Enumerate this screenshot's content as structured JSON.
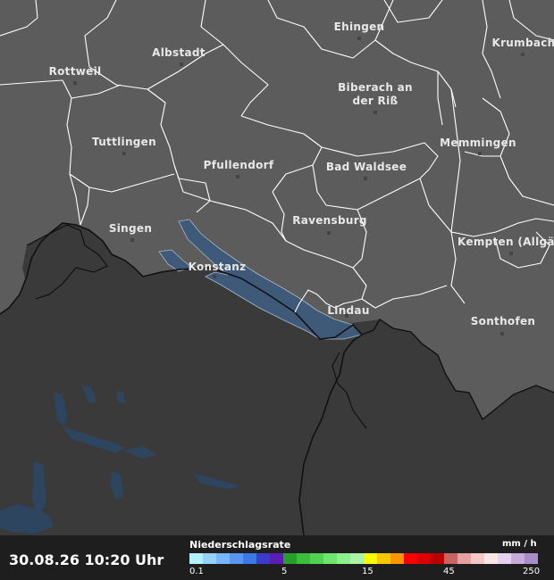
{
  "cities": [
    {
      "name": "Ehingen"
    },
    {
      "name": "Krumbach"
    },
    {
      "name": "Albstadt"
    },
    {
      "name": "Rottweil"
    },
    {
      "name": "Biberach an"
    },
    {
      "name": "der Riß"
    },
    {
      "name": "Tuttlingen"
    },
    {
      "name": "Memmingen"
    },
    {
      "name": "Pfullendorf"
    },
    {
      "name": "Bad Waldsee"
    },
    {
      "name": "Ravensburg"
    },
    {
      "name": "Singen"
    },
    {
      "name": "Kempten (Allgäu)"
    },
    {
      "name": "Konstanz"
    },
    {
      "name": "Lindau"
    },
    {
      "name": "Sonthofen"
    }
  ],
  "footer": {
    "timestamp": "30.08.26 10:20 Uhr",
    "legend_title": "Niederschlagsrate",
    "legend_unit": "mm / h",
    "ticks": [
      "0.1",
      "5",
      "15",
      "45",
      "250"
    ],
    "scale_colors": [
      "#b4f0ff",
      "#96d2ff",
      "#78b4ff",
      "#5a96f0",
      "#3c78e6",
      "#3c3cc8",
      "#5a1eb4",
      "#28a028",
      "#3cbe3c",
      "#50d250",
      "#6ee66e",
      "#8cf08c",
      "#aaf5aa",
      "#fafa00",
      "#fac800",
      "#fa9600",
      "#fa0000",
      "#dc0000",
      "#be0000",
      "#c86464",
      "#e6a0a0",
      "#f5c8c8",
      "#fae6e6",
      "#e6d2f0",
      "#c8aadc",
      "#aa8cc8"
    ]
  }
}
